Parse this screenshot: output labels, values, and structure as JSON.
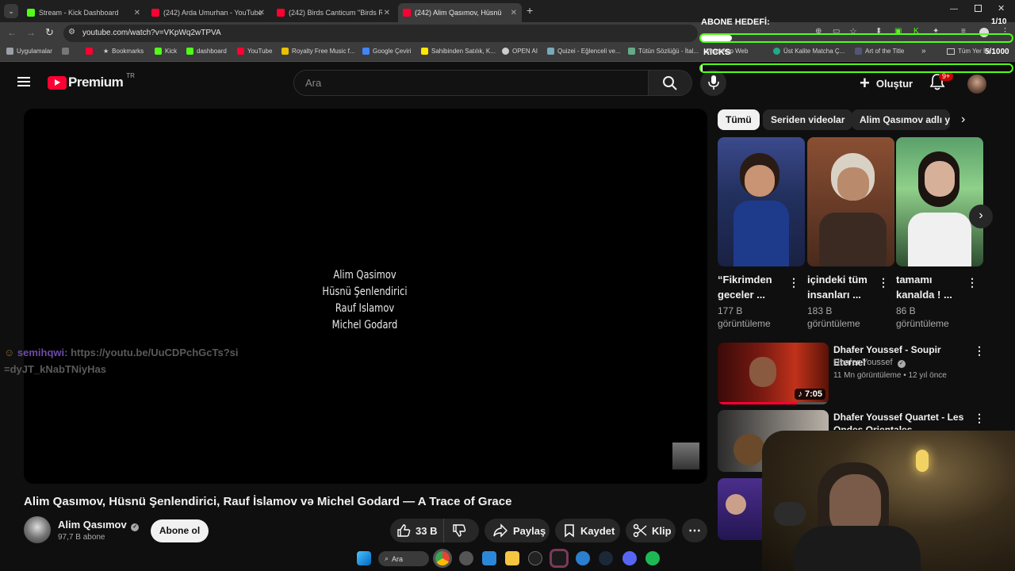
{
  "browser": {
    "tabs": [
      {
        "title": "Stream - Kick Dashboard",
        "color": "#53fc18"
      },
      {
        "title": "(242) Arda Umurhan - YouTube",
        "color": "#ff0033"
      },
      {
        "title": "(242) Birds Canticum \"Birds Req",
        "color": "#ff0033"
      },
      {
        "title": "(242) Alim Qasımov, Hüsnü Şen",
        "color": "#ff0033"
      }
    ],
    "new_tab": "+",
    "url": "youtube.com/watch?v=VKpWq2wTPVA",
    "bookmarks": [
      "Uygulamalar",
      "Bookmarks",
      "Kick",
      "dashboard",
      "YouTube",
      "Royalty Free Music f...",
      "Google Çeviri",
      "Sahibinden Satılık, K...",
      "OPEN AI",
      "Quizei - Eğlenceli ve...",
      "Tütün Sözlüğü - İtal...",
      "WhatsApp Web",
      "Üst Kalite Matcha Ç...",
      "Art of the Title",
      "Tüm Yer İm..."
    ]
  },
  "overlay": {
    "goal_label": "ABONE HEDEFİ:",
    "goal_count": "1/10",
    "goal_progress": 0.1,
    "kicks_label": "KICKS",
    "kicks_count": "5/1000",
    "kicks_progress": 0.005,
    "chat_user": "semihqwi:",
    "chat_message": "https://youtu.be/UuCDPchGcTs?si=dyJT_kNabTNiyHas"
  },
  "youtube": {
    "logo_text": "Premium",
    "logo_region": "TR",
    "search_placeholder": "Ara",
    "create_label": "Oluştur",
    "notif_badge": "9+",
    "video_overlay_lines": [
      "Alim Qasimov",
      "Hüsnü Şenlendirici",
      "Rauf Islamov",
      "Michel Godard"
    ],
    "video_title": "Alim Qasımov, Hüsnü Şenlendirici, Rauf İslamov və Michel Godard — A Trace of Grace",
    "channel_name": "Alim Qasımov",
    "subscribers": "97,7 B abone",
    "subscribe_label": "Abone ol",
    "likes": "33 B",
    "share_label": "Paylaş",
    "save_label": "Kaydet",
    "clip_label": "Klip",
    "chips": [
      "Tümü",
      "Seriden videolar",
      "Alim Qasımov adlı yüklemeden"
    ],
    "shorts": [
      {
        "title": "“Fikrimden geceler ...",
        "views": "177 B görüntüleme"
      },
      {
        "title": "içindeki tüm insanları ...",
        "views": "183 B görüntüleme"
      },
      {
        "title": "tamamı kanalda ! ...",
        "views": "86 B görüntüleme"
      }
    ],
    "recommended": [
      {
        "title": "Dhafer Youssef - Soupir Eternel",
        "channel": "Dhafer Youssef",
        "meta": "11 Mn görüntüleme • 12 yıl önce",
        "duration": "7:05"
      },
      {
        "title": "Dhafer Youssef Quartet - Les Ondes Orientales",
        "channel": "",
        "meta": "",
        "duration": ""
      }
    ]
  },
  "taskbar": {
    "search_label": "Ara"
  }
}
